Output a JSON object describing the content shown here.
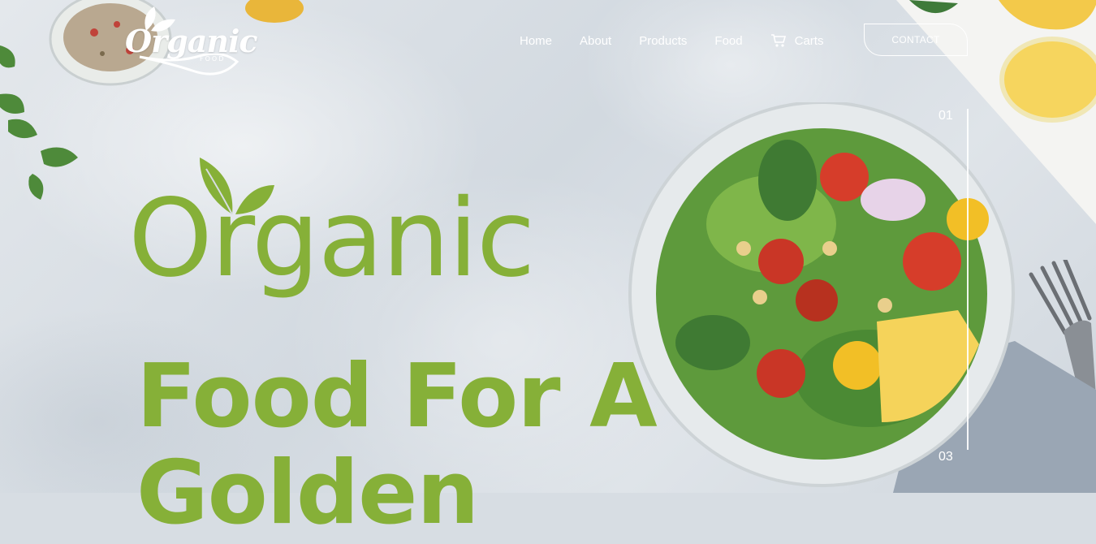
{
  "brand": {
    "logo_text": "Organic",
    "logo_sub": "FOOD"
  },
  "nav": {
    "items": [
      {
        "label": "Home"
      },
      {
        "label": "About"
      },
      {
        "label": "Products"
      },
      {
        "label": "Food"
      },
      {
        "label": "Carts",
        "icon": "cart-icon"
      }
    ],
    "contact_label": "CONTACT"
  },
  "hero": {
    "title": "Organic",
    "subtitle_line1": "Food For A",
    "subtitle_line2": "Golden"
  },
  "slider": {
    "first": "01",
    "last": "03"
  },
  "colors": {
    "accent": "#86b038",
    "nav_text": "#ffffff"
  }
}
